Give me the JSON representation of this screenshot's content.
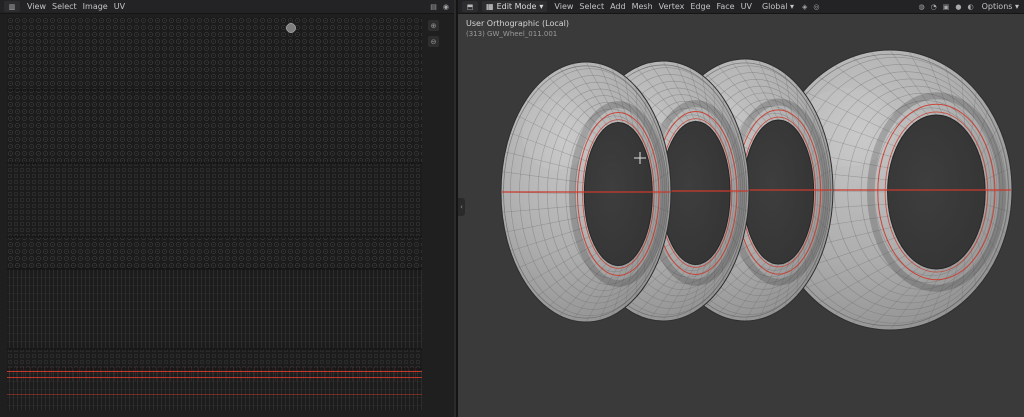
{
  "uv_editor": {
    "header": {
      "editor_type_glyph": "▥",
      "menus": [
        "View",
        "Select",
        "Image",
        "UV"
      ]
    }
  },
  "viewport": {
    "header": {
      "editor_type_glyph": "⬒",
      "mode": "Edit Mode",
      "mode_caret": "▾",
      "menus": [
        "View",
        "Select",
        "Add",
        "Mesh",
        "Vertex",
        "Edge",
        "Face",
        "UV"
      ],
      "orientation": "Global",
      "orientation_caret": "▾",
      "options_label": "Options",
      "options_caret": "▾"
    },
    "overlay": {
      "view_label": "User Orthographic (Local)",
      "object_label": "(313) GW_Wheel_011.001"
    }
  },
  "colors": {
    "selection_red": "#cc3a2c",
    "wire_gray": "#6e6e6e",
    "viewport_bg": "#3a3a3a",
    "uv_bg": "#1c1c1c"
  }
}
